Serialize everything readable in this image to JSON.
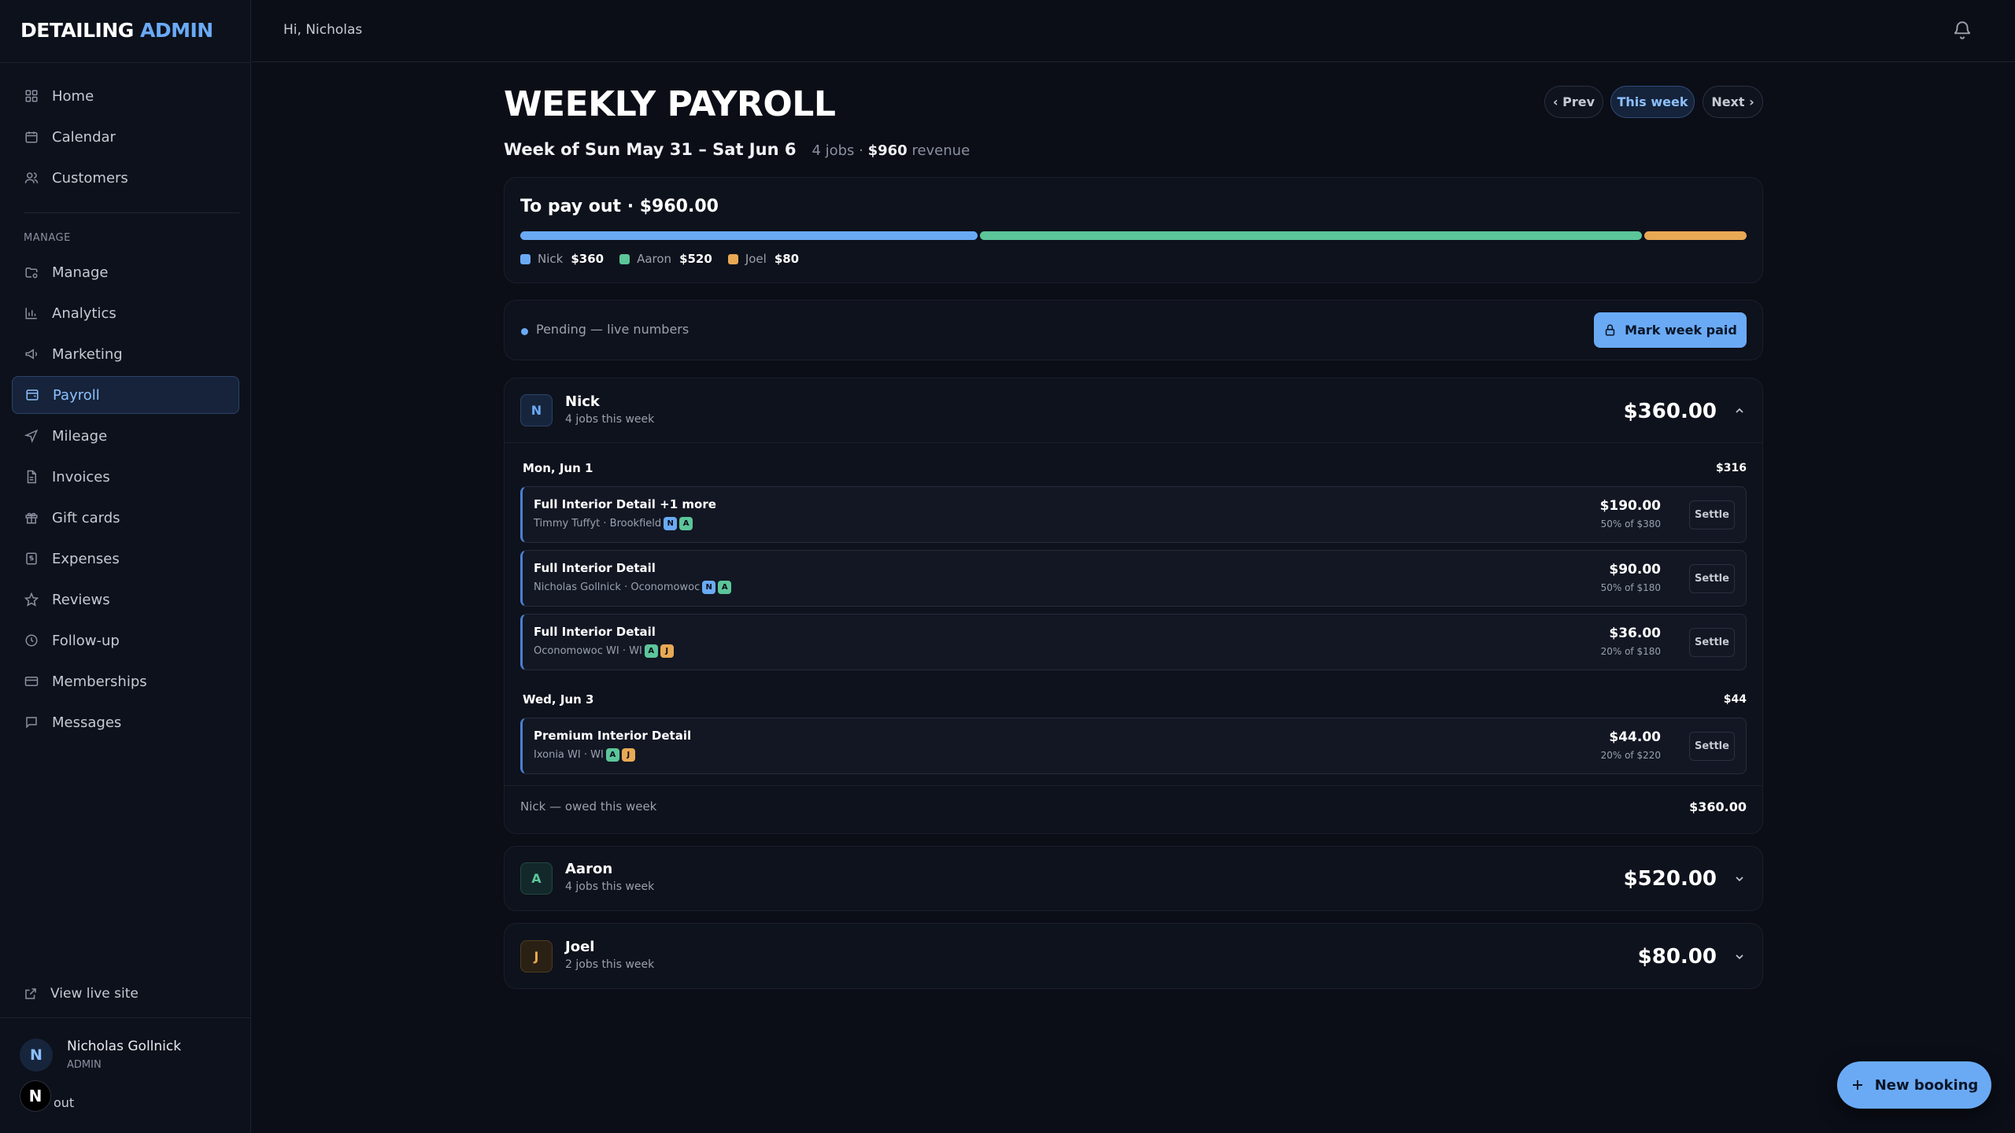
{
  "brand": {
    "primary": "DETAILING",
    "accent": "ADMIN"
  },
  "header": {
    "greeting": "Hi, Nicholas"
  },
  "sidebar": {
    "top_items": [
      {
        "label": "Home",
        "icon": "grid-icon"
      },
      {
        "label": "Calendar",
        "icon": "calendar-icon"
      },
      {
        "label": "Customers",
        "icon": "users-icon"
      }
    ],
    "section_label": "MANAGE",
    "manage_items": [
      {
        "label": "Manage",
        "icon": "folder-gear-icon"
      },
      {
        "label": "Analytics",
        "icon": "bar-chart-icon"
      },
      {
        "label": "Marketing",
        "icon": "megaphone-icon"
      },
      {
        "label": "Payroll",
        "icon": "wallet-icon",
        "active": true
      },
      {
        "label": "Mileage",
        "icon": "navigation-icon"
      },
      {
        "label": "Invoices",
        "icon": "file-icon"
      },
      {
        "label": "Gift cards",
        "icon": "gift-icon"
      },
      {
        "label": "Expenses",
        "icon": "receipt-icon"
      },
      {
        "label": "Reviews",
        "icon": "star-icon"
      },
      {
        "label": "Follow-up",
        "icon": "clock-icon"
      },
      {
        "label": "Memberships",
        "icon": "card-icon"
      },
      {
        "label": "Messages",
        "icon": "message-icon"
      }
    ],
    "view_live_site": "View live site",
    "user": {
      "initial": "N",
      "name": "Nicholas Gollnick",
      "role": "ADMIN",
      "badge": "N",
      "logout": "out"
    }
  },
  "page": {
    "title": "WEEKLY PAYROLL",
    "nav": {
      "prev": "‹ Prev",
      "current": "This week",
      "next": "Next ›"
    },
    "week_label": "Week of Sun May 31 – Sat Jun 6",
    "jobs_count": "4 jobs ·",
    "revenue_amount": "$960",
    "revenue_word": "revenue"
  },
  "payout": {
    "title": "To pay out · $960.00",
    "shares": [
      {
        "name": "Nick",
        "amount": "$360",
        "value": 360,
        "color": "#6aaaf5"
      },
      {
        "name": "Aaron",
        "amount": "$520",
        "value": 520,
        "color": "#5cc59a"
      },
      {
        "name": "Joel",
        "amount": "$80",
        "value": 80,
        "color": "#e8a954"
      }
    ]
  },
  "status": {
    "text": "Pending — live numbers",
    "button": "Mark week paid"
  },
  "employees": [
    {
      "initial": "N",
      "name": "Nick",
      "jobs": "4 jobs this week",
      "total": "$360.00",
      "days": [
        {
          "label": "Mon, Jun 1",
          "amount": "$316",
          "jobs": [
            {
              "title": "Full Interior Detail +1 more",
              "sub": "Timmy Tuffyt · Brookfield",
              "chips": [
                "N",
                "A"
              ],
              "amount": "$190.00",
              "pct": "50% of $380",
              "settle": "Settle"
            },
            {
              "title": "Full Interior Detail",
              "sub": "Nicholas Gollnick · Oconomowoc",
              "chips": [
                "N",
                "A"
              ],
              "amount": "$90.00",
              "pct": "50% of $180",
              "settle": "Settle"
            },
            {
              "title": "Full Interior Detail",
              "sub": "Oconomowoc WI · WI",
              "chips": [
                "A",
                "J"
              ],
              "amount": "$36.00",
              "pct": "20% of $180",
              "settle": "Settle"
            }
          ]
        },
        {
          "label": "Wed, Jun 3",
          "amount": "$44",
          "jobs": [
            {
              "title": "Premium Interior Detail",
              "sub": "Ixonia WI · WI",
              "chips": [
                "A",
                "J"
              ],
              "amount": "$44.00",
              "pct": "20% of $220",
              "settle": "Settle"
            }
          ]
        }
      ],
      "owed_label": "Nick — owed this week",
      "owed_amount": "$360.00"
    },
    {
      "initial": "A",
      "name": "Aaron",
      "jobs": "4 jobs this week",
      "total": "$520.00"
    },
    {
      "initial": "J",
      "name": "Joel",
      "jobs": "2 jobs this week",
      "total": "$80.00"
    }
  ],
  "fab": {
    "label": "New booking"
  },
  "colors": {
    "accent": "#6aaaf5",
    "nick": "#6aaaf5",
    "aaron": "#5cc59a",
    "joel": "#e8a954",
    "background": "#0b0e17"
  }
}
